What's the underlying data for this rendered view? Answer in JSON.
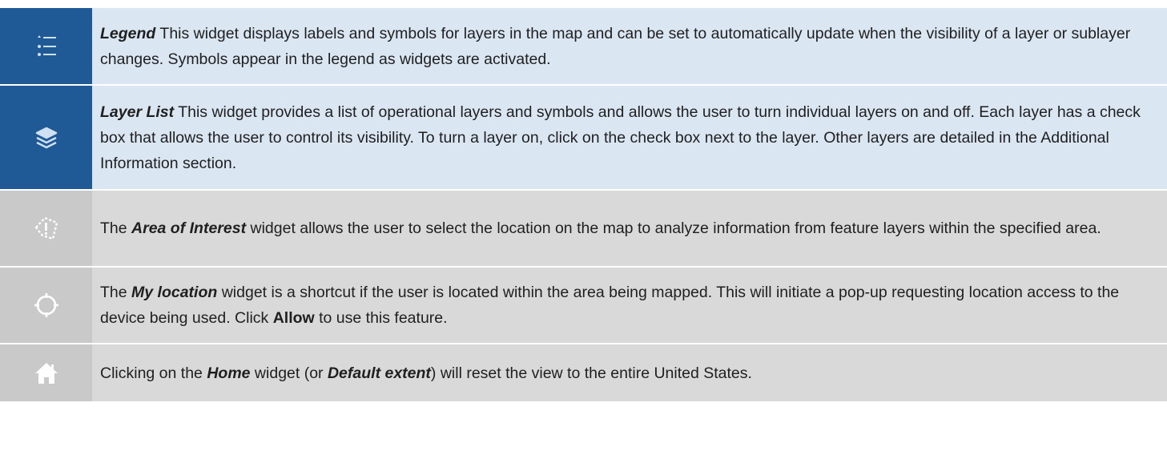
{
  "rows": [
    {
      "icon": "legend-list-icon",
      "title": "Legend",
      "text": " This widget displays labels and symbols for layers in the map and can be set to automatically update when the visibility of a layer or sublayer changes. Symbols appear in the legend as widgets are activated."
    },
    {
      "icon": "layers-stack-icon",
      "title": "Layer List",
      "text": " This widget provides a list of operational layers and symbols and allows the user to turn individual layers on and off. Each layer has a check box that allows the user to control its visibility. To turn a layer on, click on the check box next to the layer. Other layers are detailed in the Additional Information section."
    },
    {
      "icon": "area-of-interest-icon",
      "prefix": "The ",
      "title": "Area of Interest",
      "text": " widget allows the user to select the location on the map to analyze information from feature layers within the specified area."
    },
    {
      "icon": "my-location-icon",
      "prefix": "The ",
      "title": "My location",
      "text_a": " widget is a shortcut if the user is located within the area being mapped. This will initiate a pop-up requesting location access to the device being used. Click ",
      "bold": "Allow",
      "text_b": " to use this feature."
    },
    {
      "icon": "home-icon",
      "prefix": "Clicking on the ",
      "title": "Home",
      "mid": " widget (or ",
      "title2": "Default extent",
      "text": ") will reset the view to the entire United States."
    }
  ],
  "colors": {
    "blue_icon_bg": "#1f5a96",
    "blue_text_bg": "#dbe6f3",
    "gray_icon_bg": "#c9c9c9",
    "gray_text_bg": "#d9d9d9"
  }
}
